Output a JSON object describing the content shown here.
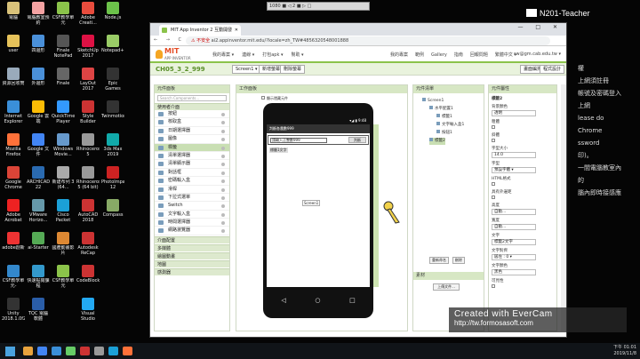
{
  "desktop": {
    "icons": [
      {
        "label": "電腦",
        "color": "#d9c27a",
        "col": 0,
        "row": 0
      },
      {
        "label": "電腦教室預約",
        "color": "#f4a2a2",
        "col": 1,
        "row": 0
      },
      {
        "label": "CSF教學單元",
        "color": "#8bc34a",
        "col": 2,
        "row": 0
      },
      {
        "label": "Adobe Creati...",
        "color": "#e84c3d",
        "col": 3,
        "row": 0
      },
      {
        "label": "Node.js",
        "color": "#6cc24a",
        "col": 4,
        "row": 0
      },
      {
        "label": "user",
        "color": "#e6c25a",
        "col": 0,
        "row": 1
      },
      {
        "label": "四邊形",
        "color": "#4a90d9",
        "col": 1,
        "row": 1
      },
      {
        "label": "Finale NotePad",
        "color": "#555",
        "col": 2,
        "row": 1
      },
      {
        "label": "SketchUp 2017",
        "color": "#d14",
        "col": 3,
        "row": 1
      },
      {
        "label": "Notepad++",
        "color": "#9c6",
        "col": 4,
        "row": 1
      },
      {
        "label": "資源回收筒",
        "color": "#9ab",
        "col": 0,
        "row": 2
      },
      {
        "label": "外邊形",
        "color": "#4a90d9",
        "col": 1,
        "row": 2
      },
      {
        "label": "Finale",
        "color": "#666",
        "col": 2,
        "row": 2
      },
      {
        "label": "LayOut 2017",
        "color": "#d44",
        "col": 3,
        "row": 2
      },
      {
        "label": "Epic Games Launcher",
        "color": "#333",
        "col": 4,
        "row": 2
      },
      {
        "label": "Internet Explorer",
        "color": "#3a8fd9",
        "col": 0,
        "row": 3
      },
      {
        "label": "Google 雲端",
        "color": "#fbbc05",
        "col": 1,
        "row": 3
      },
      {
        "label": "QuickTime Player",
        "color": "#39f",
        "col": 2,
        "row": 3
      },
      {
        "label": "Style Builder 2017",
        "color": "#c33",
        "col": 3,
        "row": 3
      },
      {
        "label": "Twinmotion",
        "color": "#333",
        "col": 4,
        "row": 3
      },
      {
        "label": "Mozilla Firefox",
        "color": "#ff7139",
        "col": 0,
        "row": 4
      },
      {
        "label": "Google 文件",
        "color": "#4285f4",
        "col": 1,
        "row": 4
      },
      {
        "label": "Windows Movie...",
        "color": "#69c",
        "col": 2,
        "row": 4
      },
      {
        "label": "Rhinoceros 5",
        "color": "#999",
        "col": 3,
        "row": 4
      },
      {
        "label": "3ds Max 2019",
        "color": "#1aa",
        "col": 4,
        "row": 4
      },
      {
        "label": "Google Chrome",
        "color": "#db4437",
        "col": 0,
        "row": 5
      },
      {
        "label": "ARCHICAD 22",
        "color": "#2a6ab0",
        "col": 1,
        "row": 5
      },
      {
        "label": "新建布列 3 (64...",
        "color": "#aaa",
        "col": 2,
        "row": 5
      },
      {
        "label": "Rhinoceros 5 (64 bit)",
        "color": "#999",
        "col": 3,
        "row": 5
      },
      {
        "label": "PhotoImpact 12",
        "color": "#c22",
        "col": 4,
        "row": 5
      },
      {
        "label": "Adobe Acrobat DC",
        "color": "#e22",
        "col": 0,
        "row": 6
      },
      {
        "label": "VMware Horizo...",
        "color": "#69a",
        "col": 1,
        "row": 6
      },
      {
        "label": "Cisco Packet Tracer",
        "color": "#1ba0d7",
        "col": 2,
        "row": 6
      },
      {
        "label": "AutoCAD 2018",
        "color": "#c33",
        "col": 3,
        "row": 6
      },
      {
        "label": "Compass",
        "color": "#8a6",
        "col": 4,
        "row": 6
      },
      {
        "label": "adobe創新",
        "color": "#e33",
        "col": 0,
        "row": 7
      },
      {
        "label": "ai-Starter",
        "color": "#5a5",
        "col": 1,
        "row": 7
      },
      {
        "label": "國產動畫影片",
        "color": "#d83",
        "col": 2,
        "row": 7
      },
      {
        "label": "Autodesk ReCap",
        "color": "#c33",
        "col": 3,
        "row": 7
      },
      {
        "label": "CSF教學單元-ClienSide",
        "color": "#38c",
        "col": 0,
        "row": 8
      },
      {
        "label": "快速點閱課程",
        "color": "#39c",
        "col": 1,
        "row": 8
      },
      {
        "label": "CSF教學單元",
        "color": "#8bc34a",
        "col": 2,
        "row": 8
      },
      {
        "label": "CodeBlocks",
        "color": "#c33",
        "col": 3,
        "row": 8
      },
      {
        "label": "Unity 2018.1.0f2",
        "color": "#333",
        "col": 0,
        "row": 9
      },
      {
        "label": "TQC 電腦軟體",
        "color": "#2a5da8",
        "col": 1,
        "row": 9
      },
      {
        "label": "Visual Studio Code",
        "color": "#23a9f2",
        "col": 3,
        "row": 9
      }
    ],
    "topbar_text": "1080 ■ ◁ 2 ■ ▷ □",
    "n201_label": "N201-Teacher",
    "bg_lines": [
      "權",
      "上網須註冊",
      "帳號及密碼登入",
      "上網",
      "lease do",
      "Chrome",
      "ssword",
      "印)。",
      "一間電腦教室內",
      "的",
      "腦內即時接感應"
    ]
  },
  "browser": {
    "tab_title": "MIT App Inventor 2 互動開發",
    "tab_close": "✕",
    "window_controls": "— □ ✕",
    "nav": "← → C",
    "url_warn": "⚠ 不安全",
    "url": "ai2.appinventor.mit.edu/?locale=zh_TW#4856320548001888"
  },
  "ai": {
    "logo_top": "MIT",
    "logo_sub": "APP INVENTOR",
    "menu": [
      "我的專案 ▾",
      "連線 ▾",
      "打包apk ▾",
      "幫助 ▾"
    ],
    "links": [
      "我的專案",
      "範例",
      "Gallery",
      "指南",
      "回報問題",
      "繁體中文 ▾"
    ],
    "email": "sw@gm.cab.edu.tw ▾",
    "project_name": "CH05_3_2_999",
    "screen_btn": "Screen1 ▾",
    "add_screen": "新增螢幕",
    "del_screen": "刪除螢幕",
    "designer_btn": "畫面編排",
    "blocks_btn": "程式設計"
  },
  "palette": {
    "title": "元件面板",
    "search": "Search Components...",
    "category": "使用者介面",
    "items": [
      "按鈕",
      "核取盒",
      "日期選擇器",
      "圖像",
      "標籤",
      "清單選擇器",
      "清單顯示器",
      "對話框",
      "密碼輸入盒",
      "滑桿",
      "下拉式選單",
      "Switch",
      "文字輸入盒",
      "時間選擇器",
      "網路瀏覽器"
    ],
    "selected_index": 4,
    "categories_more": [
      "介面配置",
      "多媒體",
      "繪圖動畫",
      "地圖",
      "感測器"
    ]
  },
  "viewer": {
    "title": "工作面板",
    "checkbox": "顯示隱藏元件",
    "status": "▾◢ ▮ 9:48",
    "app_title": "判斷各農數999",
    "textbox": "請輸入正整數999",
    "button": "判斷",
    "label": "標籤1文字",
    "screen_label": "Screen1",
    "nav": [
      "◁",
      "○",
      "□"
    ]
  },
  "tree": {
    "title": "元件清單",
    "nodes": [
      {
        "label": "Screen1",
        "indent": 0
      },
      {
        "label": "水平配置1",
        "indent": 1
      },
      {
        "label": "標籤1",
        "indent": 2
      },
      {
        "label": "文字輸入盒1",
        "indent": 2
      },
      {
        "label": "按鈕1",
        "indent": 2
      },
      {
        "label": "標籤2",
        "indent": 1
      }
    ],
    "selected_index": 5,
    "rename": "重新命名",
    "delete": "刪除",
    "media_title": "素材",
    "upload": "上傳文件..."
  },
  "props": {
    "title": "元件屬性",
    "component": "標籤2",
    "fields": [
      {
        "label": "背景顏色",
        "value": "透明"
      },
      {
        "label": "粗體",
        "check": true
      },
      {
        "label": "斜體",
        "check": true
      },
      {
        "label": "字型大小",
        "value": "14.0"
      },
      {
        "label": "字型",
        "value": "預設字體 ▾"
      },
      {
        "label": "HTML格式",
        "check": true
      },
      {
        "label": "具有外邊距",
        "check": true
      },
      {
        "label": "高度",
        "value": "自動..."
      },
      {
        "label": "寬度",
        "value": "自動..."
      },
      {
        "label": "文字",
        "value": "標籤2文字"
      },
      {
        "label": "文字對齊",
        "value": "居左 : 0 ▾"
      },
      {
        "label": "文字顏色",
        "value": "黑色"
      },
      {
        "label": "可見性",
        "check": true
      }
    ]
  },
  "watermark": {
    "line1": "Created with EverCam",
    "line2": "http://tw.formosasoft.com"
  },
  "taskbar": {
    "clock_time": "下午 01:01",
    "clock_date": "2019/11/8"
  }
}
